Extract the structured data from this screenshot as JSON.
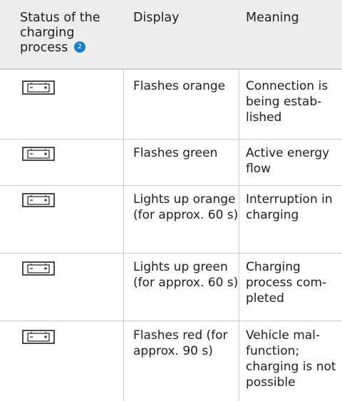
{
  "header": {
    "col1": "Status of the charging process",
    "badge": "2",
    "col2": "Display",
    "col3": "Meaning"
  },
  "icons": {
    "status": "battery-charging-icon"
  },
  "rows": [
    {
      "display": "Flashes orange",
      "meaning": "Connection is being estab-lished"
    },
    {
      "display": "Flashes green",
      "meaning": "Active energy flow"
    },
    {
      "display": "Lights up orange (for approx. 60 s)",
      "meaning": "Interruption in charging"
    },
    {
      "display": "Lights up green (for approx. 60 s)",
      "meaning": "Charging process com-pleted"
    },
    {
      "display": "Flashes red (for approx. 90 s)",
      "meaning": "Vehicle mal-function; charging is not possible"
    }
  ]
}
